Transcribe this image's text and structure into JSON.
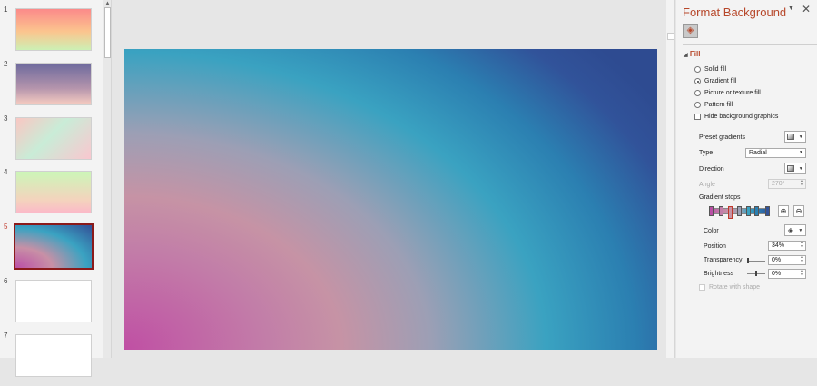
{
  "thumbnails": [
    {
      "num": "1",
      "bg": "linear-gradient(180deg,#fb8a8a,#fbc58e 55%,#cdf0b4)",
      "active": false
    },
    {
      "num": "2",
      "bg": "linear-gradient(180deg,#6e6a9d,#b494ac 60%,#f6ccc1)",
      "active": false
    },
    {
      "num": "3",
      "bg": "linear-gradient(135deg,#f9c7c3,#c9ecd7 45%,#f9c7cf)",
      "active": false
    },
    {
      "num": "4",
      "bg": "linear-gradient(180deg,#ccf6b8,#f4d3bd 70%,#fbb9c8)",
      "active": false
    },
    {
      "num": "5",
      "bg": "radial-gradient(ellipse at 0% 100%,#bb4fa6,#c890a6 34%,#3aa3c2 66%,#334f96)",
      "active": true
    },
    {
      "num": "6",
      "bg": "#ffffff",
      "active": false
    },
    {
      "num": "7",
      "bg": "#ffffff",
      "active": false
    }
  ],
  "slide": {
    "background": "radial-gradient(ellipse 120% 150% at 0% 100%, #c04fa4 0%, #c27da8 22%, #c693a5 34%, #9c9fb5 48%, #3aa2c1 66%, #2b7fb1 80%, #31539a 92%, #2e4b91 100%)"
  },
  "pane": {
    "title": "Format Background",
    "dropdown_icon": "chevron-down-icon",
    "close_icon": "close-icon",
    "fill_icon": "paint-bucket-icon",
    "section_label": "Fill",
    "options": {
      "solid": "Solid fill",
      "gradient": "Gradient fill",
      "picture": "Picture or texture fill",
      "pattern": "Pattern fill",
      "hide": "Hide background graphics"
    },
    "selected_option": "gradient",
    "labels": {
      "preset": "Preset gradients",
      "type": "Type",
      "direction": "Direction",
      "angle": "Angle",
      "stops": "Gradient stops",
      "color": "Color",
      "position": "Position",
      "transparency": "Transparency",
      "brightness": "Brightness",
      "rotate": "Rotate with shape"
    },
    "values": {
      "type": "Radial",
      "angle": "270°",
      "position": "34%",
      "transparency": "0%",
      "brightness": "0%"
    },
    "gradient_stops": [
      {
        "color": "#b94fa5",
        "position": 0
      },
      {
        "color": "#c27da8",
        "position": 0.17
      },
      {
        "color": "#c693a5",
        "position": 0.34
      },
      {
        "color": "#9c9fb5",
        "position": 0.5
      },
      {
        "color": "#3aa2c1",
        "position": 0.66
      },
      {
        "color": "#2b7fb1",
        "position": 0.8
      },
      {
        "color": "#31539a",
        "position": 1
      }
    ],
    "selected_stop": 2,
    "accent": "#b7472a"
  }
}
